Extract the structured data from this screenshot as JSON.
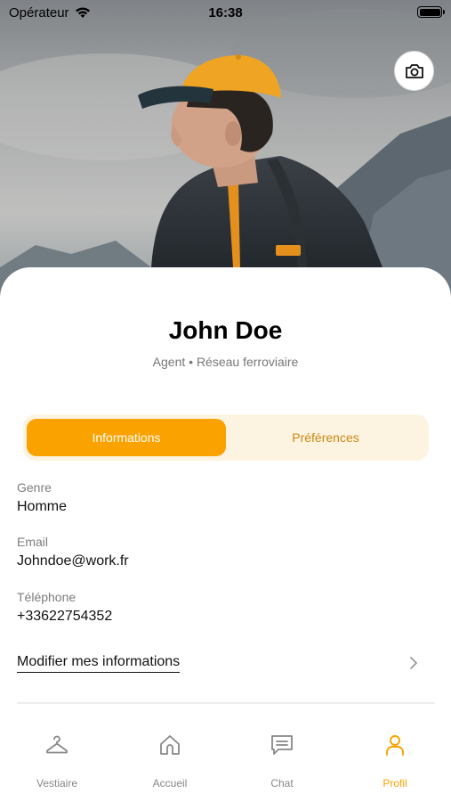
{
  "status_bar": {
    "carrier": "Opérateur",
    "time": "16:38"
  },
  "profile": {
    "name": "John Doe",
    "role": "Agent • Réseau ferroviaire"
  },
  "segments": {
    "active": "Informations",
    "inactive": "Préférences"
  },
  "fields": [
    {
      "label": "Genre",
      "value": "Homme"
    },
    {
      "label": "Email",
      "value": "Johndoe@work.fr"
    },
    {
      "label": "Téléphone",
      "value": "+33622754352"
    }
  ],
  "edit_link": "Modifier mes informations",
  "tabs": [
    {
      "label": "Vestiaire",
      "icon": "hanger-icon"
    },
    {
      "label": "Accueil",
      "icon": "home-icon"
    },
    {
      "label": "Chat",
      "icon": "chat-icon"
    },
    {
      "label": "Profil",
      "icon": "user-icon",
      "active": true
    }
  ],
  "colors": {
    "accent": "#f9a200",
    "accent_light": "#fdf3e1",
    "accent_text": "#c98a12"
  }
}
